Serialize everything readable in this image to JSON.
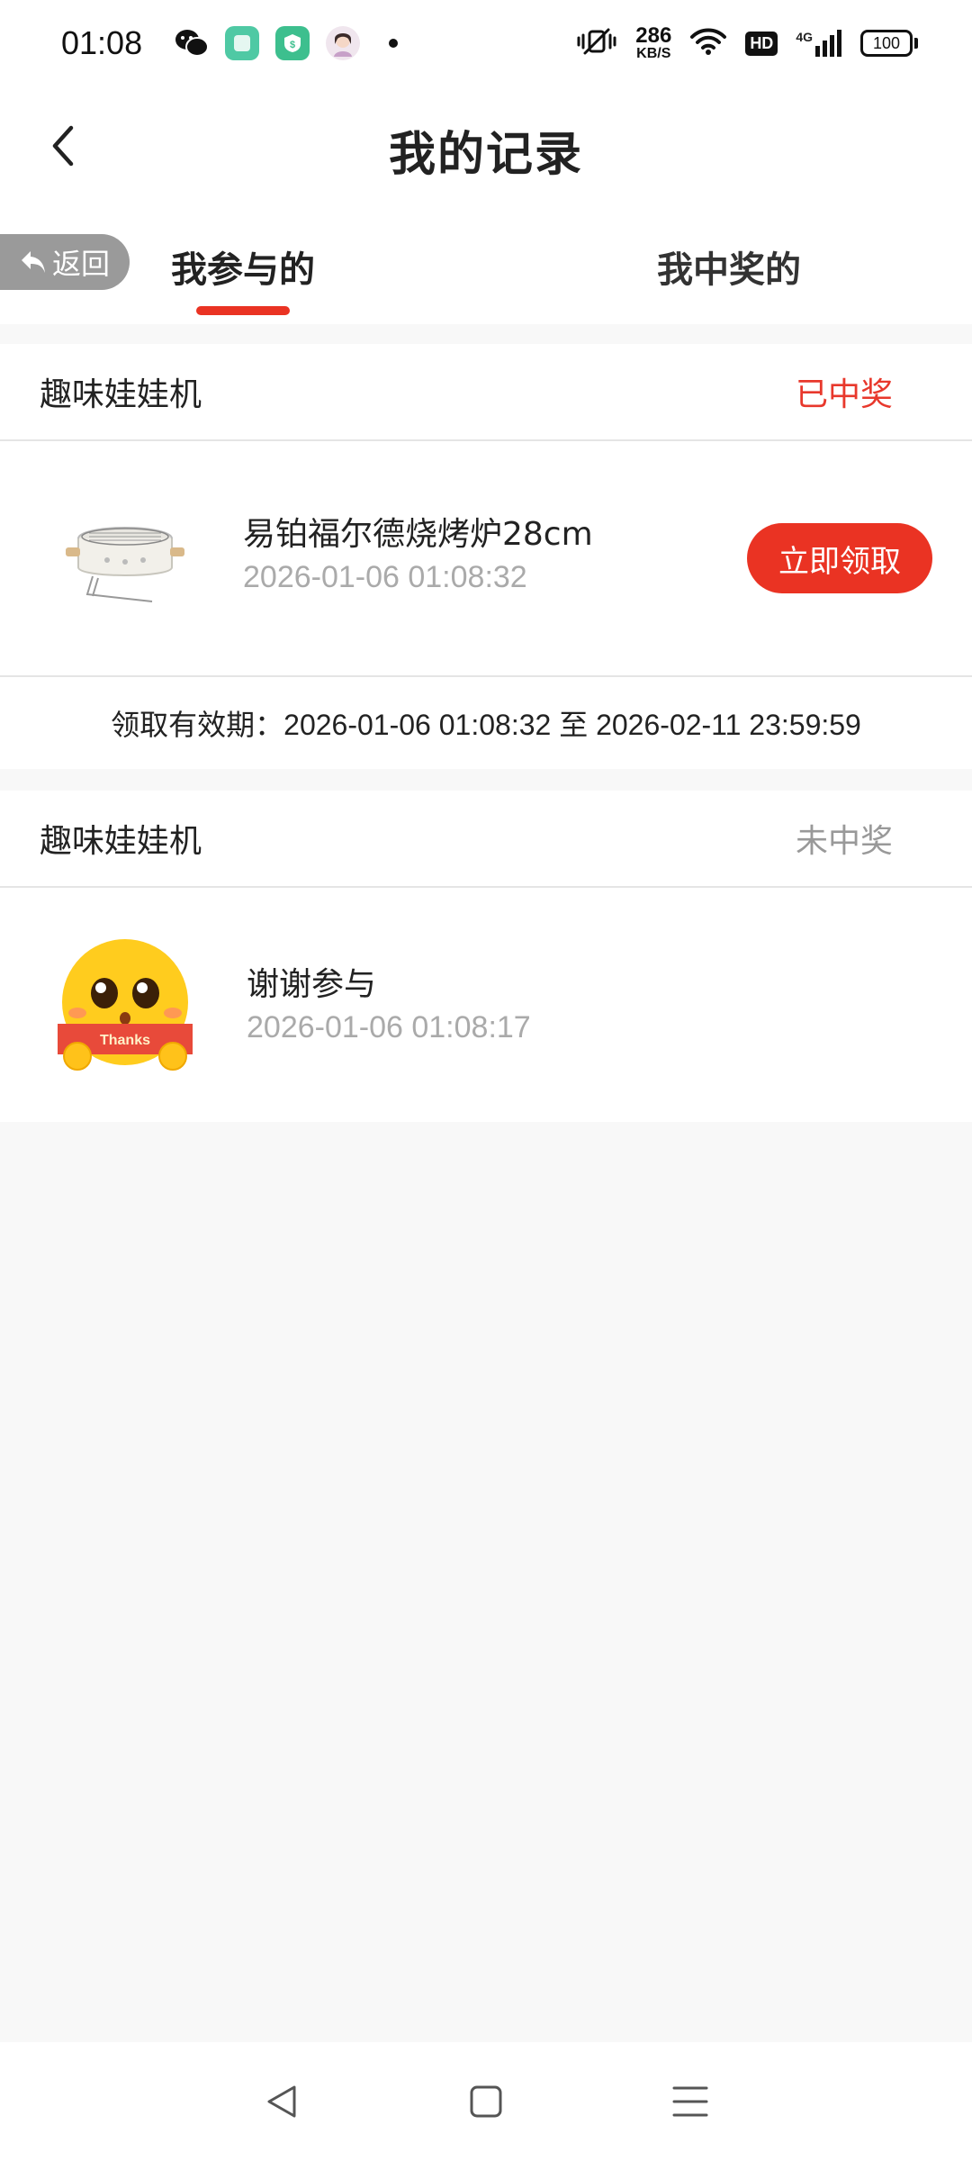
{
  "status_bar": {
    "time": "01:08",
    "net_speed": "286",
    "net_unit": "KB/S",
    "hd": "HD",
    "network_type": "4G",
    "battery": "100"
  },
  "header": {
    "title": "我的记录",
    "back_icon": "chevron-left-icon"
  },
  "tabs": {
    "return_label": "返回",
    "items": [
      {
        "label": "我参与的",
        "active": true
      },
      {
        "label": "我中奖的",
        "active": false
      }
    ],
    "accent_color": "#ea3323"
  },
  "records": [
    {
      "game": "趣味娃娃机",
      "status": "已中奖",
      "prize_name": "易铂福尔德烧烤炉28cm",
      "time": "2026-01-06 01:08:32",
      "action_label": "立即领取",
      "validity_label": "领取有效期：",
      "validity_range": "2026-01-06 01:08:32 至 2026-02-11 23:59:59"
    },
    {
      "game": "趣味娃娃机",
      "status": "未中奖",
      "prize_name": "谢谢参与",
      "time": "2026-01-06 01:08:17",
      "badge_text": "Thanks"
    }
  ],
  "nav_bar": {
    "back_icon": "triangle-back-icon",
    "home_icon": "square-home-icon",
    "menu_icon": "menu-lines-icon"
  }
}
